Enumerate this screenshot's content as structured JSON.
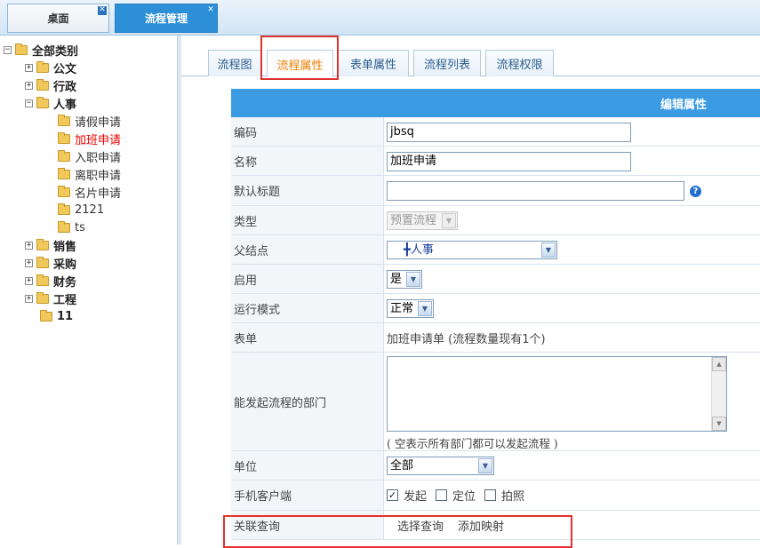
{
  "top_tabs": [
    {
      "label": "桌面",
      "close": "✕"
    },
    {
      "label": "流程管理",
      "close": "✕"
    }
  ],
  "tree": {
    "root": "全部类别",
    "nodes": [
      {
        "label": "公文",
        "expander": "+"
      },
      {
        "label": "行政",
        "expander": "+"
      },
      {
        "label": "人事",
        "expander": "−"
      },
      {
        "label": "请假申请"
      },
      {
        "label": "加班申请",
        "selected": true
      },
      {
        "label": "入职申请"
      },
      {
        "label": "离职申请"
      },
      {
        "label": "名片申请"
      },
      {
        "label": "2121"
      },
      {
        "label": "ts"
      },
      {
        "label": "销售",
        "expander": "+"
      },
      {
        "label": "采购",
        "expander": "+"
      },
      {
        "label": "财务",
        "expander": "+"
      },
      {
        "label": "工程",
        "expander": "+"
      },
      {
        "label": "11"
      }
    ],
    "root_expander": "−"
  },
  "content_tabs": [
    {
      "label": "流程图"
    },
    {
      "label": "流程属性",
      "active": true
    },
    {
      "label": "表单属性"
    },
    {
      "label": "流程列表"
    },
    {
      "label": "流程权限"
    }
  ],
  "form": {
    "header": "编辑属性",
    "code": {
      "label": "编码",
      "value": "jbsq"
    },
    "name": {
      "label": "名称",
      "value": "加班申请"
    },
    "default_title": {
      "label": "默认标题",
      "value": "",
      "help": "?"
    },
    "type": {
      "label": "类型",
      "value": "预置流程"
    },
    "parent": {
      "label": "父结点",
      "value": "╋人事"
    },
    "enabled": {
      "label": "启用",
      "value": "是"
    },
    "run_mode": {
      "label": "运行模式",
      "value": "正常"
    },
    "form_row": {
      "label": "表单",
      "value": "加班申请单 (流程数量现有1个)"
    },
    "departments": {
      "label": "能发起流程的部门",
      "hint": "( 空表示所有部门都可以发起流程 )"
    },
    "unit": {
      "label": "单位",
      "value": "全部"
    },
    "mobile": {
      "label": "手机客户端",
      "options": [
        {
          "label": "发起",
          "checked": true
        },
        {
          "label": "定位",
          "checked": false
        },
        {
          "label": "拍照",
          "checked": false
        }
      ]
    },
    "related_query": {
      "label": "关联查询",
      "links": [
        "选择查询",
        "添加映射"
      ]
    }
  },
  "icons": {
    "dropdown": "▼",
    "scroll_up": "▲",
    "scroll_down": "▼",
    "check": "✓"
  },
  "colors": {
    "accent_blue": "#3a9be2",
    "active_tab_text": "#f07d00",
    "highlight_red": "#e0322f",
    "selected_node": "#e00000"
  }
}
